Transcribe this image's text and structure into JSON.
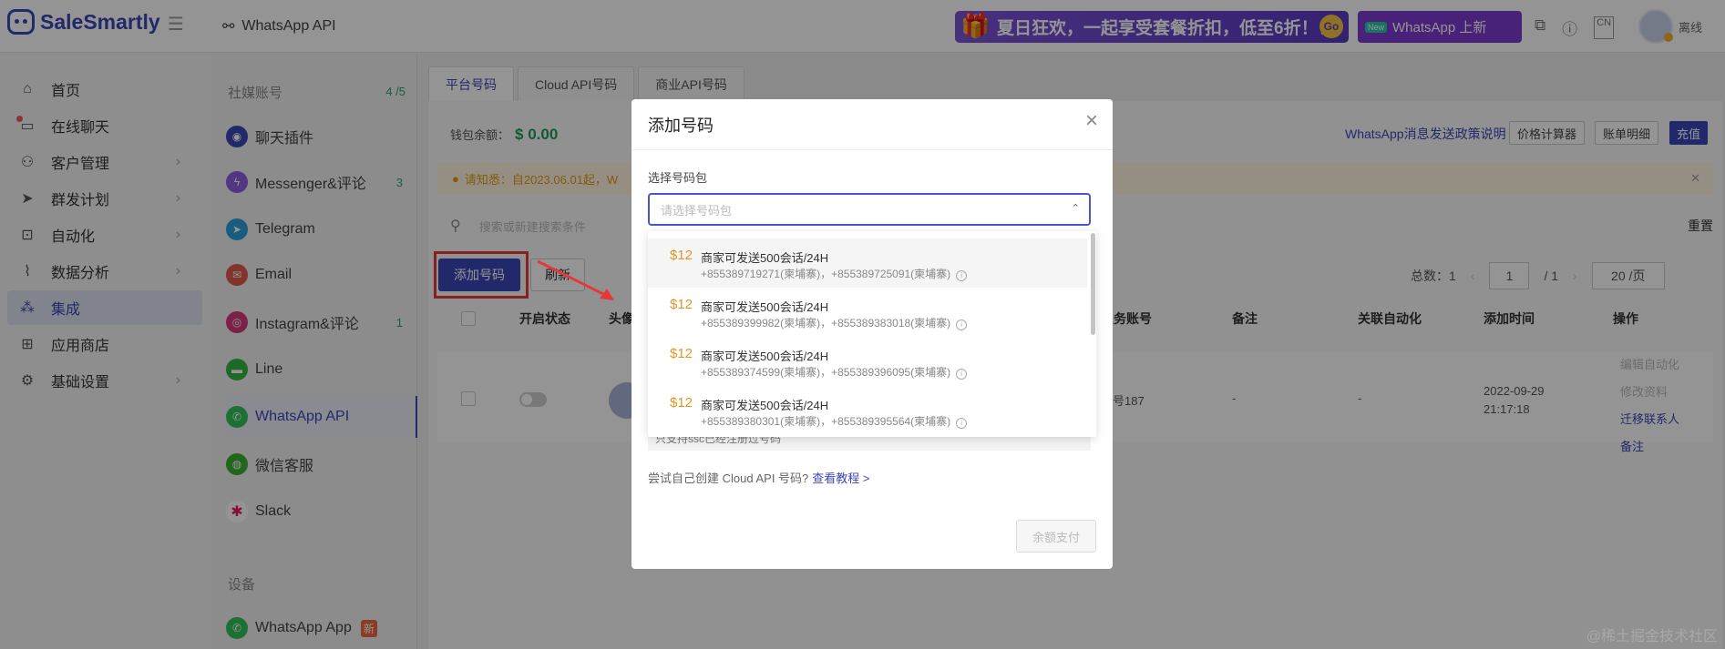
{
  "header": {
    "brand": "SaleSmartly",
    "breadcrumb": "WhatsApp API",
    "promo_text": "夏日狂欢，一起享受套餐折扣，低至6折！！",
    "promo_go": "Go",
    "wa_new_tag": "New",
    "wa_new_text": "WhatsApp 上新",
    "lang": "CN",
    "user_status": "离线"
  },
  "nav": {
    "items": [
      {
        "label": "首页"
      },
      {
        "label": "在线聊天"
      },
      {
        "label": "客户管理"
      },
      {
        "label": "群发计划"
      },
      {
        "label": "自动化"
      },
      {
        "label": "数据分析"
      },
      {
        "label": "集成"
      },
      {
        "label": "应用商店"
      },
      {
        "label": "基础设置"
      }
    ]
  },
  "channels": {
    "section_title": "社媒账号",
    "section_count": "4 /5",
    "items": [
      {
        "label": "聊天插件",
        "count": ""
      },
      {
        "label": "Messenger&评论",
        "count": "3"
      },
      {
        "label": "Telegram",
        "count": ""
      },
      {
        "label": "Email",
        "count": ""
      },
      {
        "label": "Instagram&评论",
        "count": "1"
      },
      {
        "label": "Line",
        "count": ""
      },
      {
        "label": "WhatsApp API",
        "count": ""
      },
      {
        "label": "微信客服",
        "count": ""
      },
      {
        "label": "Slack",
        "count": ""
      }
    ],
    "device_title": "设备",
    "device_item": "WhatsApp App",
    "device_badge": "新"
  },
  "main": {
    "tabs": [
      "平台号码",
      "Cloud API号码",
      "商业API号码"
    ],
    "wallet_label": "钱包余额：",
    "wallet_value": "$ 0.00",
    "policy_link": "WhatsApp消息发送政策说明",
    "btn_price": "价格计算器",
    "btn_bill": "账单明细",
    "btn_recharge": "充值",
    "notice": "请知悉：自2023.06.01起，W",
    "search_placeholder": "搜索或新建搜索条件",
    "reset": "重置",
    "btn_add": "添加号码",
    "btn_refresh": "刷新",
    "pager": {
      "total_label": "总数：1",
      "page": "1",
      "of": "/ 1",
      "per_page": "20 /页"
    },
    "columns": [
      "开启状态",
      "头像",
      "业务账号",
      "备注",
      "关联自动化",
      "添加时间",
      "操作"
    ],
    "row": {
      "account": "账号187",
      "note": "-",
      "automation": "-",
      "date": "2022-09-29",
      "time": "21:17:18",
      "ops": [
        "编辑自动化",
        "修改资料",
        "迁移联系人",
        "备注"
      ]
    }
  },
  "modal": {
    "title": "添加号码",
    "field_label": "选择号码包",
    "placeholder": "请选择号码包",
    "hidden_hint": "只支持ssc已经注册过号码",
    "tip_text": "尝试自己创建 Cloud API 号码?",
    "tip_link": "查看教程 >",
    "pay_button": "余额支付",
    "options": [
      {
        "price": "$12",
        "name": "商家可发送500会话/24H",
        "numbers": "+855389719271(柬埔寨)，+855389725091(柬埔寨)"
      },
      {
        "price": "$12",
        "name": "商家可发送500会话/24H",
        "numbers": "+855389399982(柬埔寨)，+855389383018(柬埔寨)"
      },
      {
        "price": "$12",
        "name": "商家可发送500会话/24H",
        "numbers": "+855389374599(柬埔寨)，+855389396095(柬埔寨)"
      },
      {
        "price": "$12",
        "name": "商家可发送500会话/24H",
        "numbers": "+855389380301(柬埔寨)，+855389395564(柬埔寨)"
      }
    ]
  },
  "watermark": "@稀土掘金技术社区",
  "colors": {
    "primary": "#3b47b8",
    "price": "#e2961f",
    "highlight": "#e53935"
  }
}
